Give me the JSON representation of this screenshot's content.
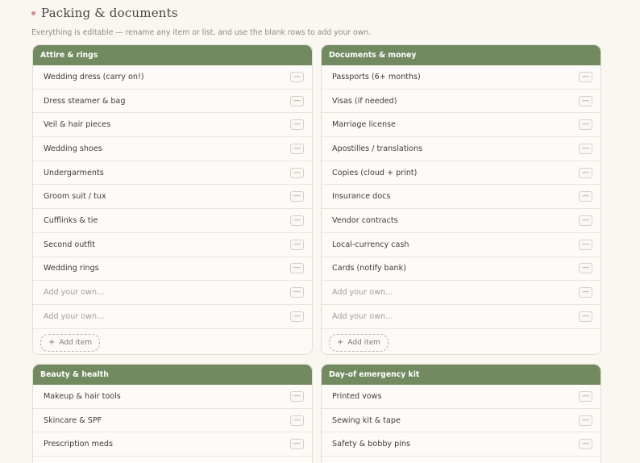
{
  "header": {
    "title": "Packing & documents",
    "subtitle": "Everything is editable — rename any item or list, and use the blank rows to add your own.",
    "accent_color": "#d88a8a"
  },
  "colors": {
    "card_header": "#728a60",
    "background": "#faf7f2"
  },
  "add_item_label": "Add item",
  "add_icon": "plus-icon",
  "remove_icon": "minus-icon",
  "lists": {
    "attire": {
      "title": "Attire & rings",
      "items": [
        "Wedding dress (carry on!)",
        "Dress steamer & bag",
        "Veil & hair pieces",
        "Wedding shoes",
        "Undergarments",
        "Groom suit / tux",
        "Cufflinks & tie",
        "Second outfit",
        "Wedding rings"
      ],
      "placeholders": [
        "Add your own…",
        "Add your own…"
      ]
    },
    "documents": {
      "title": "Documents & money",
      "items": [
        "Passports (6+ months)",
        "Visas (if needed)",
        "Marriage license",
        "Apostilles / translations",
        "Copies (cloud + print)",
        "Insurance docs",
        "Vendor contracts",
        "Local-currency cash",
        "Cards (notify bank)"
      ],
      "placeholders": [
        "Add your own…",
        "Add your own…"
      ]
    },
    "beauty": {
      "title": "Beauty & health",
      "items": [
        "Makeup & hair tools",
        "Skincare & SPF",
        "Prescription meds"
      ]
    },
    "kit": {
      "title": "Day-of emergency kit",
      "items": [
        "Printed vows",
        "Sewing kit & tape",
        "Safety & bobby pins"
      ]
    }
  }
}
